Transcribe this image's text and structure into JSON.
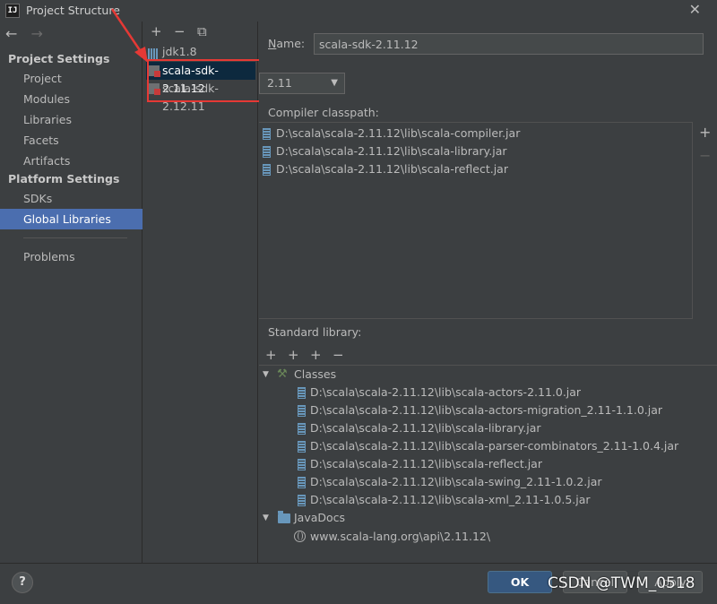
{
  "window": {
    "app_icon": "IJ",
    "title": "Project Structure",
    "close_glyph": "✕"
  },
  "nav": {
    "back_glyph": "←",
    "forward_glyph": "→",
    "project_settings_header": "Project Settings",
    "project_settings_items": [
      "Project",
      "Modules",
      "Libraries",
      "Facets",
      "Artifacts"
    ],
    "platform_settings_header": "Platform Settings",
    "platform_settings_items": [
      "SDKs",
      "Global Libraries"
    ],
    "selected_item": "Global Libraries",
    "problems": "Problems"
  },
  "libraries": {
    "toolbar": {
      "add": "+",
      "remove": "−",
      "copy": "⧉"
    },
    "items": [
      {
        "label": "jdk1.8",
        "icon": "jdk-icon"
      },
      {
        "label": "scala-sdk-2.11.12",
        "icon": "scala-sdk-icon",
        "selected": true
      },
      {
        "label": "scala-sdk-2.12.11",
        "icon": "scala-sdk-icon"
      }
    ]
  },
  "detail": {
    "name_label_prefix": "",
    "name_label_mnemonic": "N",
    "name_label_rest": "ame:",
    "name_value": "scala-sdk-2.11.12",
    "version_value": "2.11",
    "compiler_classpath_label": "Compiler classpath:",
    "compiler_classpath": [
      "D:\\scala\\scala-2.11.12\\lib\\scala-compiler.jar",
      "D:\\scala\\scala-2.11.12\\lib\\scala-library.jar",
      "D:\\scala\\scala-2.11.12\\lib\\scala-reflect.jar"
    ],
    "side_add": "+",
    "side_remove": "−",
    "standard_library_label": "Standard library:",
    "std_toolbar": {
      "add": "+",
      "add_alt": "+",
      "add_other": "+",
      "remove": "−"
    },
    "classes_label": "Classes",
    "classes": [
      "D:\\scala\\scala-2.11.12\\lib\\scala-actors-2.11.0.jar",
      "D:\\scala\\scala-2.11.12\\lib\\scala-actors-migration_2.11-1.1.0.jar",
      "D:\\scala\\scala-2.11.12\\lib\\scala-library.jar",
      "D:\\scala\\scala-2.11.12\\lib\\scala-parser-combinators_2.11-1.0.4.jar",
      "D:\\scala\\scala-2.11.12\\lib\\scala-reflect.jar",
      "D:\\scala\\scala-2.11.12\\lib\\scala-swing_2.11-1.0.2.jar",
      "D:\\scala\\scala-2.11.12\\lib\\scala-xml_2.11-1.0.5.jar"
    ],
    "javadocs_label": "JavaDocs",
    "javadocs": [
      "www.scala-lang.org\\api\\2.11.12\\"
    ],
    "expand_glyph": "▼"
  },
  "footer": {
    "help": "?",
    "ok": "OK",
    "cancel": "Cancel",
    "apply": "Apply"
  },
  "watermark": "CSDN @TWM_0518",
  "colors": {
    "background": "#3c3f41",
    "selection_nav": "#4b6eaf",
    "selection_list": "#0d293e",
    "annotation_red": "#e53935",
    "ok_button": "#365880"
  }
}
